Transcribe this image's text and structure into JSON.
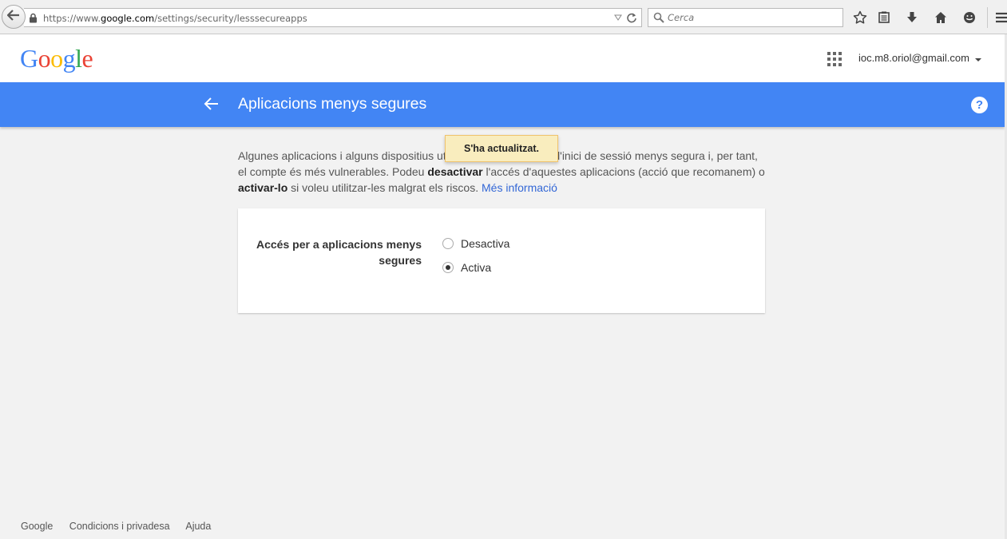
{
  "browser": {
    "url_prefix": "https://www.",
    "url_domain": "google.com",
    "url_path": "/settings/security/lesssecureapps",
    "search_placeholder": "Cerca"
  },
  "header": {
    "logo": [
      "G",
      "o",
      "o",
      "g",
      "l",
      "e"
    ],
    "logo_colors": [
      "#4285f4",
      "#ea4335",
      "#fbbc05",
      "#4285f4",
      "#34a853",
      "#ea4335"
    ],
    "account": "ioc.m8.oriol@gmail.com"
  },
  "page": {
    "title": "Aplicacions menys segures",
    "toast": "S'ha actualitzat.",
    "intro": {
      "part1": "Algunes aplicacions i alguns dispositius utilitzen una tecnologia d'inici de sessió menys segura i, per tant, el compte és més vulnerables. Podeu ",
      "bold1": "desactivar",
      "part2": " l'accés d'aquestes aplicacions (acció que recomanem) o ",
      "bold2": "activar-lo",
      "part3": " si voleu utilitzar-les malgrat els riscos. ",
      "link": "Més informació"
    },
    "setting": {
      "label": "Accés per a aplicacions menys segures",
      "options": [
        {
          "label": "Desactiva",
          "checked": false
        },
        {
          "label": "Activa",
          "checked": true
        }
      ]
    }
  },
  "footer": {
    "links": [
      "Google",
      "Condicions i privadesa",
      "Ajuda"
    ]
  },
  "colors": {
    "accent": "#4285f4",
    "toast_bg": "#f9edbe"
  }
}
